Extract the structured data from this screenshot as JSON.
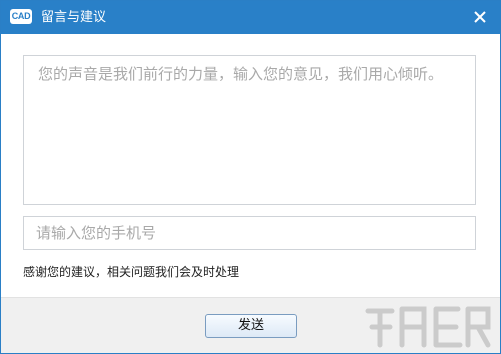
{
  "window": {
    "title": "留言与建议",
    "logo_text": "CAD",
    "close_icon": "close-icon"
  },
  "form": {
    "feedback_placeholder": "您的声音是我们前行的力量，输入您的意见，我们用心倾听。",
    "phone_placeholder": "请输入您的手机号",
    "notice": "感谢您的建议，相关问题我们会及时处理"
  },
  "footer": {
    "send_label": "发送"
  },
  "colors": {
    "titlebar": "#2980c8",
    "placeholder": "#a9a9a9",
    "footer_bg": "#f0f0f0"
  }
}
